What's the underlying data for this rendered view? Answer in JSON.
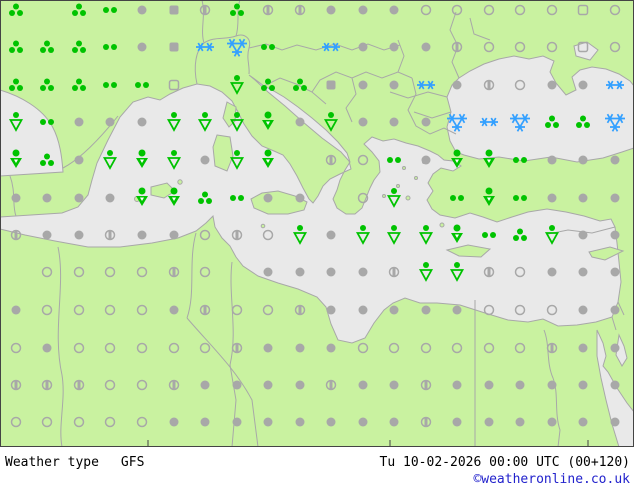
{
  "footer": {
    "left_label": "Weather type",
    "model": "GFS",
    "timestamp": "Tu 10-02-2026 00:00 UTC (00+120)",
    "copyright": "©weatheronline.co.uk"
  },
  "map": {
    "colors": {
      "land": "#c9f2a0",
      "sea": "#e9e9e9",
      "coast": "#a8a8a8",
      "frame": "#444444",
      "symbol_green": "#00c300",
      "symbol_gray": "#a8a8a8",
      "symbol_blue": "#33a0ff"
    },
    "legend": {
      "R3": "rain",
      "R2": "drizzle",
      "SH": "light-shower",
      "SH2": "shower",
      "CL": "cloudy",
      "PC": "partly-cloudy",
      "SU": "clear",
      "FG": "fog",
      "FG2": "light-fog",
      "SN": "snow",
      "SN3": "heavy-snow"
    },
    "grid": {
      "col_x": [
        16,
        47,
        79,
        110,
        142,
        174,
        205,
        237,
        268,
        300,
        331,
        363,
        394,
        426,
        457,
        489,
        520,
        552,
        583,
        615
      ],
      "row_y": [
        10,
        47,
        85,
        122,
        160,
        198,
        235,
        272,
        310,
        348,
        385,
        422
      ],
      "cells": [
        [
          "R3",
          "",
          "R3",
          "R2",
          "CL",
          "FG",
          "PC",
          "R3",
          "PC",
          "PC",
          "CL",
          "CL",
          "CL",
          "SU",
          "SU",
          "SU",
          "SU",
          "SU",
          "FG2",
          "SU"
        ],
        [
          "R3",
          "R3",
          "R3",
          "R2",
          "CL",
          "FG",
          "SN",
          "SN3",
          "R2",
          "",
          "SN",
          "CL",
          "CL",
          "CL",
          "PC",
          "SU",
          "SU",
          "SU",
          "FG2",
          "SU"
        ],
        [
          "R3",
          "R3",
          "R3",
          "R2",
          "R2",
          "FG2",
          "",
          "SH",
          "R3",
          "R3",
          "FG",
          "CL",
          "CL",
          "SN",
          "CL",
          "PC",
          "SU",
          "CL",
          "CL",
          "SN"
        ],
        [
          "SH",
          "R2",
          "CL",
          "CL",
          "CL",
          "SH",
          "SH",
          "SH",
          "SH2",
          "CL",
          "SH",
          "CL",
          "CL",
          "CL",
          "SN3",
          "SN",
          "SN3",
          "R3",
          "R3",
          "SN3"
        ],
        [
          "SH2",
          "R3",
          "CL",
          "SH",
          "SH2",
          "SH",
          "CL",
          "SH",
          "SH2",
          "",
          "PC",
          "SU",
          "R2",
          "CL",
          "SH2",
          "SH2",
          "R2",
          "CL",
          "CL",
          "CL"
        ],
        [
          "CL",
          "CL",
          "CL",
          "CL",
          "SH2",
          "SH2",
          "R3",
          "R2",
          "CL",
          "CL",
          "",
          "SU",
          "SH",
          "",
          "R2",
          "SH2",
          "R2",
          "CL",
          "CL",
          "CL"
        ],
        [
          "PC",
          "CL",
          "CL",
          "PC",
          "CL",
          "CL",
          "SU",
          "PC",
          "SU",
          "SH",
          "CL",
          "SH",
          "SH",
          "SH",
          "SH2",
          "R2",
          "R3",
          "SH",
          "CL",
          "CL"
        ],
        [
          "",
          "SU",
          "SU",
          "SU",
          "SU",
          "PC",
          "SU",
          "",
          "CL",
          "CL",
          "CL",
          "CL",
          "PC",
          "SH",
          "SH",
          "PC",
          "SU",
          "CL",
          "CL",
          "CL"
        ],
        [
          "CL",
          "SU",
          "SU",
          "SU",
          "SU",
          "CL",
          "PC",
          "SU",
          "SU",
          "PC",
          "CL",
          "CL",
          "CL",
          "CL",
          "CL",
          "SU",
          "SU",
          "SU",
          "CL",
          "CL"
        ],
        [
          "SU",
          "CL",
          "SU",
          "SU",
          "SU",
          "SU",
          "SU",
          "PC",
          "CL",
          "CL",
          "CL",
          "SU",
          "SU",
          "SU",
          "SU",
          "SU",
          "SU",
          "PC",
          "CL",
          "CL"
        ],
        [
          "PC",
          "PC",
          "PC",
          "SU",
          "SU",
          "PC",
          "CL",
          "CL",
          "CL",
          "CL",
          "PC",
          "CL",
          "CL",
          "PC",
          "CL",
          "CL",
          "CL",
          "CL",
          "CL",
          "CL"
        ],
        [
          "SU",
          "SU",
          "SU",
          "SU",
          "SU",
          "CL",
          "CL",
          "CL",
          "CL",
          "CL",
          "CL",
          "CL",
          "CL",
          "PC",
          "CL",
          "CL",
          "CL",
          "CL",
          "CL",
          "CL"
        ]
      ]
    }
  }
}
